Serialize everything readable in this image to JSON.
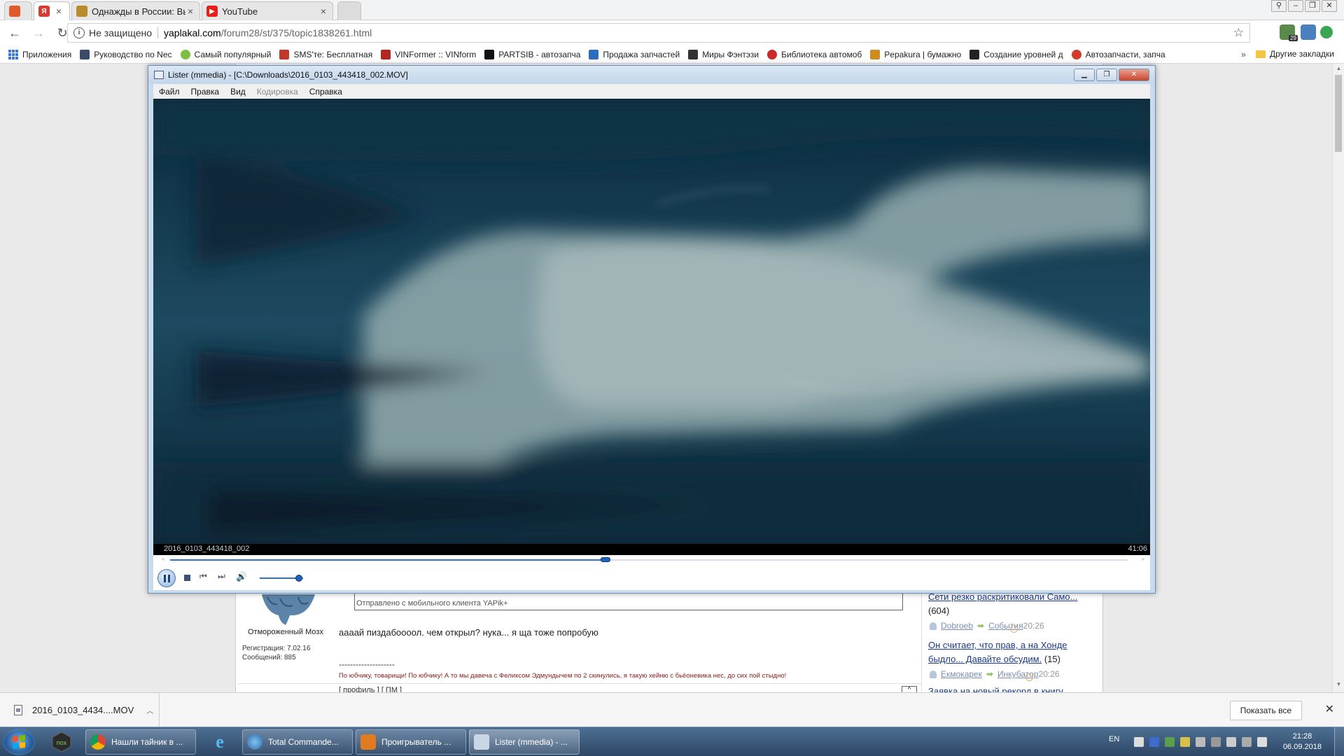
{
  "browser": {
    "tabs": [
      {
        "label": "",
        "favicon_color": "#e05a2b"
      },
      {
        "label": "",
        "favicon_color": "#d63c2f"
      },
      {
        "label": "Однажды в России: Вы",
        "favicon_color": "#b78b2e"
      },
      {
        "label": "YouTube",
        "favicon_color": "#e62117"
      }
    ],
    "url_insecure_label": "Не защищено",
    "url_host": "yaplakal.com",
    "url_path": "/forum28/st/375/topic1838261.html",
    "ext_badge": "29"
  },
  "bookmarks": [
    {
      "label": "Приложения",
      "color": "#3c78d8"
    },
    {
      "label": "Руководство по Nec",
      "color": "#3b4a66"
    },
    {
      "label": "Самый популярный",
      "color": "#7bc043"
    },
    {
      "label": "SMS'те: Бесплатная",
      "color": "#c0392b"
    },
    {
      "label": "VINFormer :: VINform",
      "color": "#b3261e"
    },
    {
      "label": "PARTSIB - автозапча",
      "color": "#111111"
    },
    {
      "label": "Продажа запчастей",
      "color": "#2a6cc4"
    },
    {
      "label": "Миры Фэнтэзи",
      "color": "#333333"
    },
    {
      "label": "Библиотека автомоб",
      "color": "#cc2a2a"
    },
    {
      "label": "Pepakura | бумажно",
      "color": "#d08a1e"
    },
    {
      "label": "Создание уровней д",
      "color": "#222222"
    },
    {
      "label": "Автозапчасти, запча",
      "color": "#d33a2c"
    }
  ],
  "bookmarks_more": "»",
  "bookmarks_other": "Другие закладки",
  "forum": {
    "quote_footer": "Отправлено с мобильного клиента YAPik+",
    "nick": "Отмороженный Мозх",
    "registration": "Регистрация: 7.02.16",
    "messages": "Сообщений: 885",
    "post_text": "аааай пиздабоооол. чем открыл? нука... я ща тоже попробую",
    "sig_line": "--------------------",
    "sig_text": "По юбчику, товарищи! По юбчику! А то мы давеча с Феликсом Эдмундычем по 2 скинулись, я такую хейню с бьёоневика нес, до сих пой стыдно!",
    "actions": "[ профиль ] [ ПМ ]",
    "up": "^"
  },
  "sidebar": [
    {
      "title": "Сети резко раскритиковали Само...",
      "count": "(604)",
      "user": "Dobroeb",
      "category": "События",
      "time": "20:26"
    },
    {
      "title": "Он считает, что прав, а на Хонде",
      "title2": "быдло... Давайте обсудим.",
      "count": "(15)",
      "user": "Екмокарек",
      "category": "Инкубатор",
      "time": "20:26"
    },
    {
      "title": "Заявка на новый рекорд в книгу"
    }
  ],
  "lister": {
    "title": "Lister (mmedia) - [C:\\Downloads\\2016_0103_443418_002.MOV]",
    "menu": [
      "Файл",
      "Правка",
      "Вид",
      "Кодировка",
      "Справка"
    ],
    "file_name": "2016_0103_443418_002",
    "duration": "41:06",
    "progress_fraction": 0.455,
    "volume_fraction": 0.9
  },
  "downloads": {
    "file": "2016_0103_4434....MOV",
    "show_all": "Показать все"
  },
  "taskbar": {
    "buttons": [
      {
        "label": "Нашли тайник в ...",
        "color": "#e8a020"
      },
      {
        "label": "Total Commande...",
        "color": "#3b7fc4"
      },
      {
        "label": "Проигрыватель ...",
        "color": "#e07b20"
      },
      {
        "label": "Lister (mmedia) - ...",
        "color": "#c8d6e6"
      }
    ],
    "lang": "EN",
    "time": "21:28",
    "date": "06.09.2018"
  }
}
